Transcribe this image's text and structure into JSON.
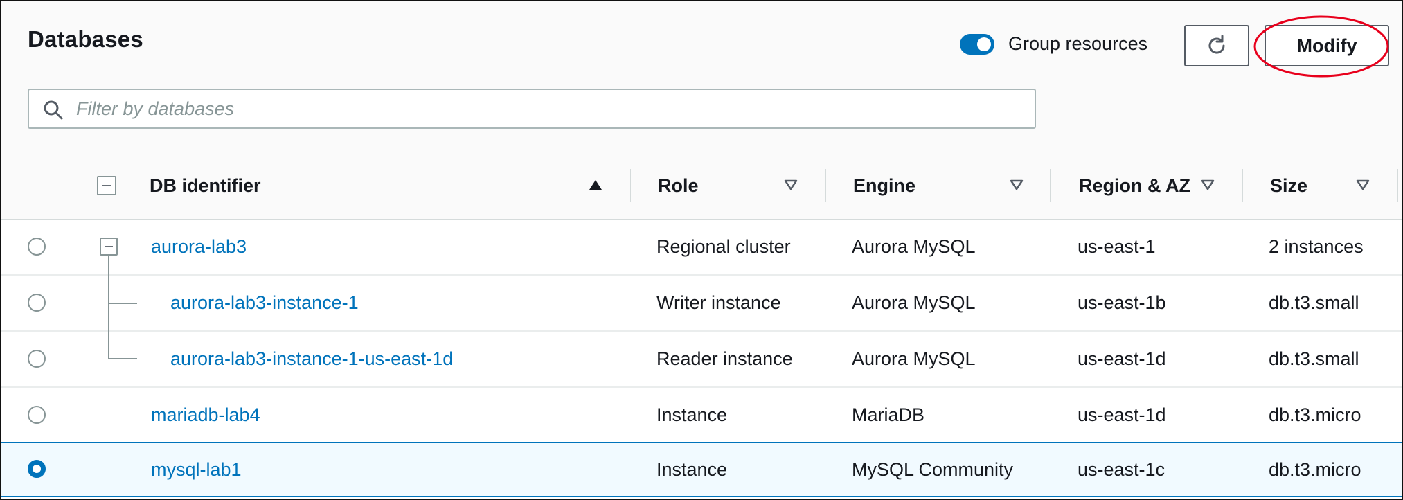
{
  "header": {
    "title": "Databases",
    "group_toggle_label": "Group resources",
    "group_toggle_on": true,
    "refresh_icon": "refresh-icon",
    "modify_label": "Modify",
    "highlight_color": "#e8001c"
  },
  "search": {
    "placeholder": "Filter by databases",
    "value": "",
    "icon": "search-icon"
  },
  "table": {
    "columns": [
      {
        "label": "DB identifier",
        "sort": "ascending"
      },
      {
        "label": "Role",
        "sort": "none"
      },
      {
        "label": "Engine",
        "sort": "none"
      },
      {
        "label": "Region & AZ",
        "sort": "none"
      },
      {
        "label": "Size",
        "sort": "none"
      }
    ],
    "rows": [
      {
        "identifier": "aurora-lab3",
        "role": "Regional cluster",
        "engine": "Aurora MySQL",
        "region": "us-east-1",
        "size": "2 instances",
        "selected": false,
        "level": 0,
        "expandable": true
      },
      {
        "identifier": "aurora-lab3-instance-1",
        "role": "Writer instance",
        "engine": "Aurora MySQL",
        "region": "us-east-1b",
        "size": "db.t3.small",
        "selected": false,
        "level": 1
      },
      {
        "identifier": "aurora-lab3-instance-1-us-east-1d",
        "role": "Reader instance",
        "engine": "Aurora MySQL",
        "region": "us-east-1d",
        "size": "db.t3.small",
        "selected": false,
        "level": 1
      },
      {
        "identifier": "mariadb-lab4",
        "role": "Instance",
        "engine": "MariaDB",
        "region": "us-east-1d",
        "size": "db.t3.micro",
        "selected": false,
        "level": 0
      },
      {
        "identifier": "mysql-lab1",
        "role": "Instance",
        "engine": "MySQL Community",
        "region": "us-east-1c",
        "size": "db.t3.micro",
        "selected": true,
        "level": 0
      }
    ]
  },
  "colors": {
    "accent": "#0073bb",
    "selected_row_bg": "#f1faff",
    "header_bg": "#fafafa"
  }
}
